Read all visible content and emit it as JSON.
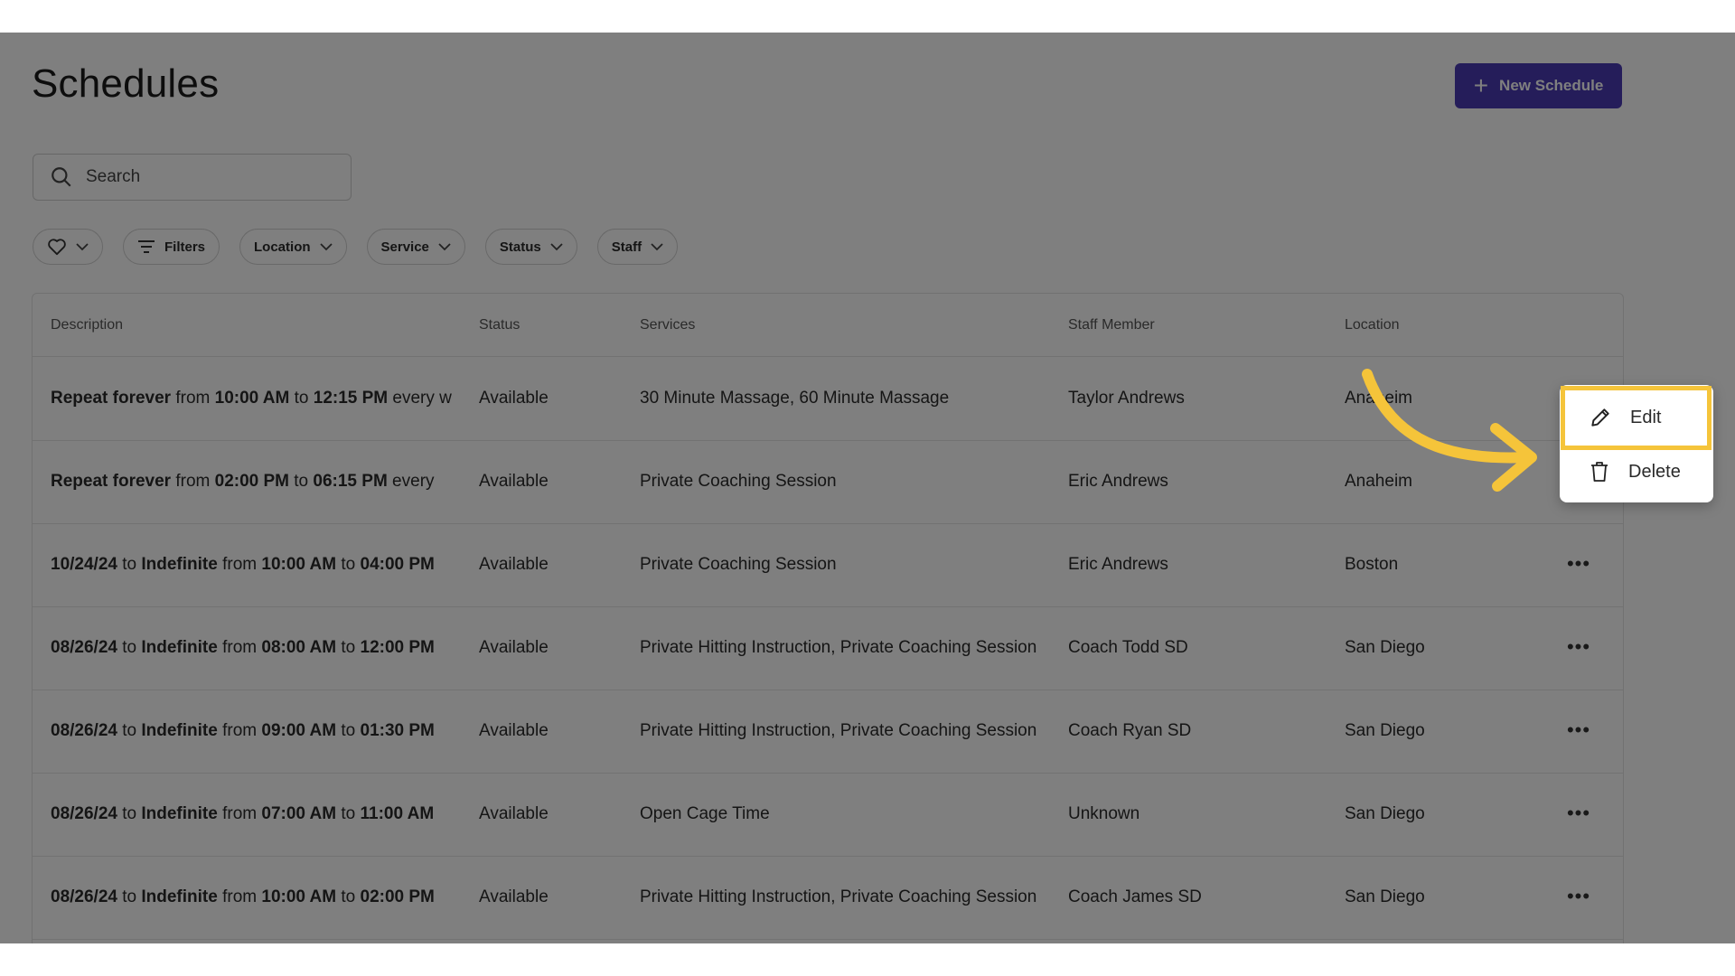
{
  "page": {
    "title": "Schedules"
  },
  "toolbar": {
    "new_schedule_label": "New Schedule"
  },
  "search": {
    "placeholder": "Search"
  },
  "filters": {
    "favorites_icon": "heart-icon",
    "filters_label": "Filters",
    "location_label": "Location",
    "service_label": "Service",
    "status_label": "Status",
    "staff_label": "Staff"
  },
  "table": {
    "headers": {
      "description": "Description",
      "status": "Status",
      "services": "Services",
      "staff": "Staff Member",
      "location": "Location"
    },
    "rows": [
      {
        "d1": "Repeat forever",
        "d2": " from ",
        "d3": "10:00 AM",
        "d4": " to ",
        "d5": "12:15 PM",
        "d6": " every w",
        "status": "Available",
        "services": "30 Minute Massage, 60 Minute Massage",
        "staff": "Taylor Andrews",
        "location": "Anaheim"
      },
      {
        "d1": "Repeat forever",
        "d2": " from ",
        "d3": "02:00 PM",
        "d4": " to ",
        "d5": "06:15 PM",
        "d6": " every",
        "status": "Available",
        "services": "Private Coaching Session",
        "staff": "Eric Andrews",
        "location": "Anaheim"
      },
      {
        "d1": "10/24/24",
        "d2": " to ",
        "d3": "Indefinite",
        "d4": " from ",
        "d5": "10:00 AM",
        "d6": " to ",
        "d7": "04:00 PM",
        "status": "Available",
        "services": "Private Coaching Session",
        "staff": "Eric Andrews",
        "location": "Boston"
      },
      {
        "d1": "08/26/24",
        "d2": " to ",
        "d3": "Indefinite",
        "d4": " from ",
        "d5": "08:00 AM",
        "d6": " to ",
        "d7": "12:00 PM",
        "status": "Available",
        "services": "Private Hitting Instruction, Private Coaching Session",
        "staff": "Coach Todd SD",
        "location": "San Diego"
      },
      {
        "d1": "08/26/24",
        "d2": " to ",
        "d3": "Indefinite",
        "d4": " from ",
        "d5": "09:00 AM",
        "d6": " to ",
        "d7": "01:30 PM",
        "status": "Available",
        "services": "Private Hitting Instruction, Private Coaching Session",
        "staff": "Coach Ryan SD",
        "location": "San Diego"
      },
      {
        "d1": "08/26/24",
        "d2": " to ",
        "d3": "Indefinite",
        "d4": " from ",
        "d5": "07:00 AM",
        "d6": " to ",
        "d7": "11:00 AM",
        "status": "Available",
        "services": "Open Cage Time",
        "staff": "Unknown",
        "location": "San Diego"
      },
      {
        "d1": "08/26/24",
        "d2": " to ",
        "d3": "Indefinite",
        "d4": " from ",
        "d5": "10:00 AM",
        "d6": " to ",
        "d7": "02:00 PM",
        "status": "Available",
        "services": "Private Hitting Instruction, Private Coaching Session",
        "staff": "Coach James SD",
        "location": "San Diego"
      }
    ],
    "more_label": "•••"
  },
  "context_menu": {
    "edit_label": "Edit",
    "delete_label": "Delete"
  },
  "colors": {
    "accent": "#4a3ab5",
    "highlight": "#f5c43a",
    "overlay": "#000000"
  }
}
